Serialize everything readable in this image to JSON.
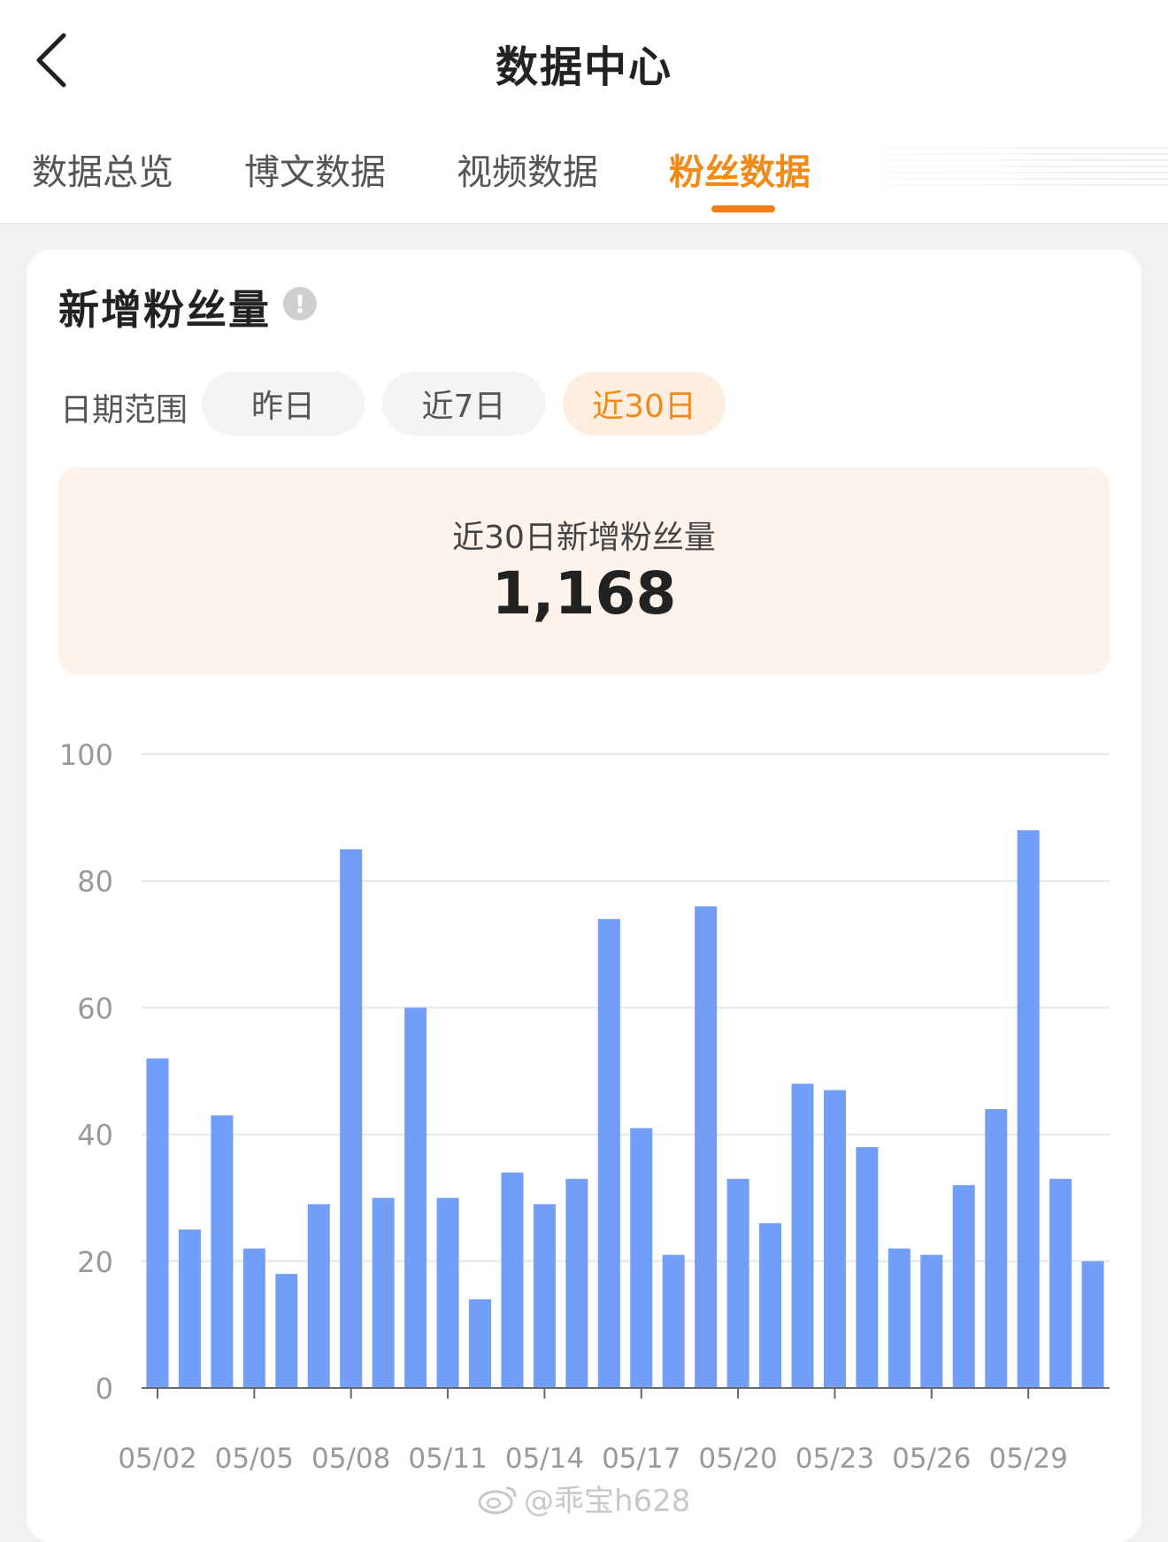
{
  "header": {
    "title": "数据中心",
    "back_icon": "chevron-left-icon"
  },
  "tabs": [
    {
      "label": "数据总览",
      "active": false
    },
    {
      "label": "博文数据",
      "active": false
    },
    {
      "label": "视频数据",
      "active": false
    },
    {
      "label": "粉丝数据",
      "active": true
    }
  ],
  "section": {
    "title": "新增粉丝量",
    "info_icon": "info-icon",
    "range_label": "日期范围",
    "ranges": [
      {
        "label": "昨日",
        "active": false
      },
      {
        "label": "近7日",
        "active": false
      },
      {
        "label": "近30日",
        "active": true
      }
    ]
  },
  "summary": {
    "label": "近30日新增粉丝量",
    "value": "1,168"
  },
  "colors": {
    "accent": "#f08a18",
    "bar": "#739ef7",
    "grid": "#e3e6ea",
    "axis_text": "#999999"
  },
  "watermark": {
    "text": "@乖宝h628",
    "icon": "weibo-icon"
  },
  "chart_data": {
    "type": "bar",
    "ylim": [
      0,
      100
    ],
    "yticks": [
      0,
      20,
      40,
      60,
      80,
      100
    ],
    "tick_labels": [
      "05/02",
      "05/05",
      "05/08",
      "05/11",
      "05/14",
      "05/17",
      "05/20",
      "05/23",
      "05/26",
      "05/29"
    ],
    "categories": [
      "05/02",
      "05/03",
      "05/04",
      "05/05",
      "05/06",
      "05/07",
      "05/08",
      "05/09",
      "05/10",
      "05/11",
      "05/12",
      "05/13",
      "05/14",
      "05/15",
      "05/16",
      "05/17",
      "05/18",
      "05/19",
      "05/20",
      "05/21",
      "05/22",
      "05/23",
      "05/24",
      "05/25",
      "05/26",
      "05/27",
      "05/28",
      "05/29",
      "05/30",
      "05/31"
    ],
    "values": [
      52,
      25,
      43,
      22,
      18,
      29,
      85,
      30,
      60,
      30,
      14,
      34,
      29,
      33,
      74,
      41,
      21,
      76,
      33,
      26,
      48,
      47,
      38,
      22,
      21,
      32,
      44,
      88,
      33,
      20
    ],
    "grid": true
  }
}
